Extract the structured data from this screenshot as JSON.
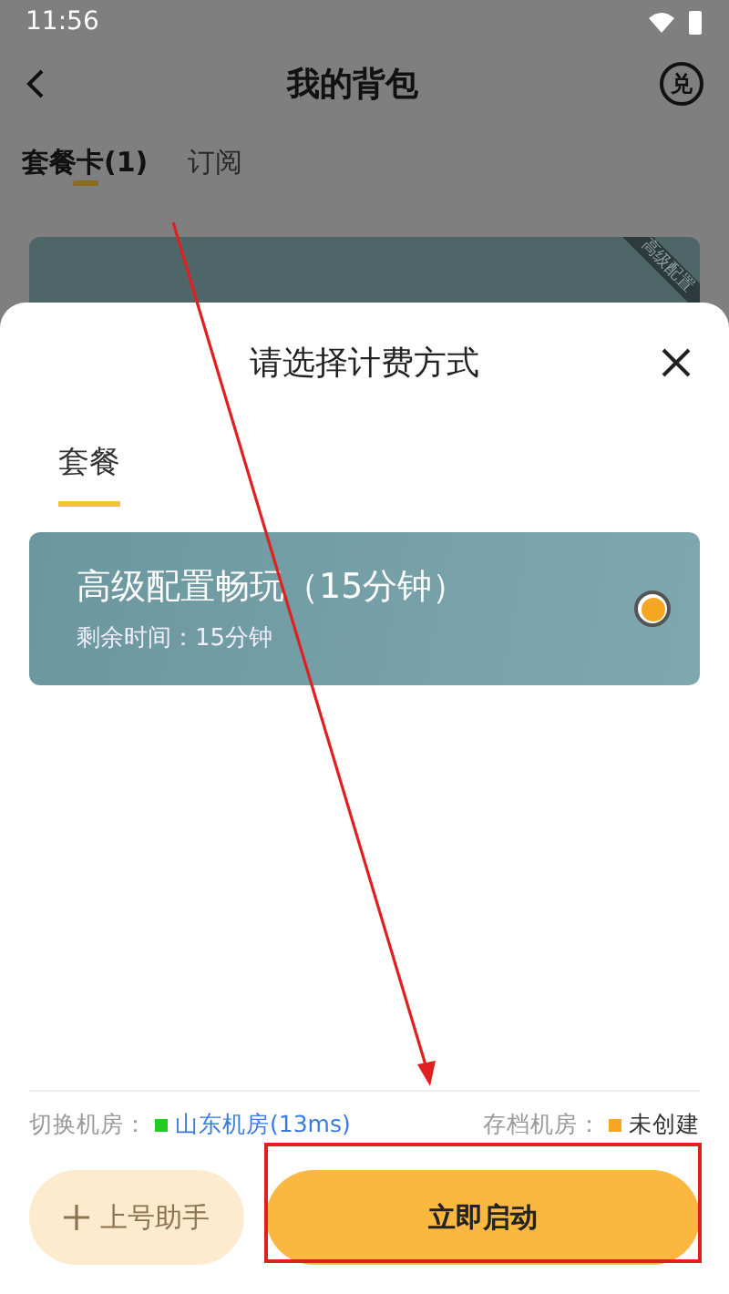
{
  "status_bar": {
    "time": "11:56"
  },
  "header": {
    "title": "我的背包",
    "action": "兑"
  },
  "tabs": [
    {
      "label": "套餐卡(1)",
      "selected": true
    },
    {
      "label": "订阅",
      "selected": false
    }
  ],
  "background_card": {
    "ribbon": "高级配置"
  },
  "sheet": {
    "title": "请选择计费方式",
    "tabs": [
      {
        "label": "套餐",
        "selected": true
      }
    ],
    "packages": [
      {
        "name": "高级配置畅玩（15分钟）",
        "remaining": "剩余时间：15分钟",
        "selected": true
      }
    ],
    "server": {
      "label": "切换机房：",
      "value": "山东机房(13ms)",
      "color": "#22cc22"
    },
    "archive": {
      "label": "存档机房：",
      "value": "未创建",
      "color": "#f5a623"
    },
    "buttons": [
      {
        "kind": "secondary",
        "label": "上号助手"
      },
      {
        "kind": "primary",
        "label": "立即启动"
      }
    ]
  },
  "annotations": {
    "arrow": true,
    "highlight_frame": true
  }
}
